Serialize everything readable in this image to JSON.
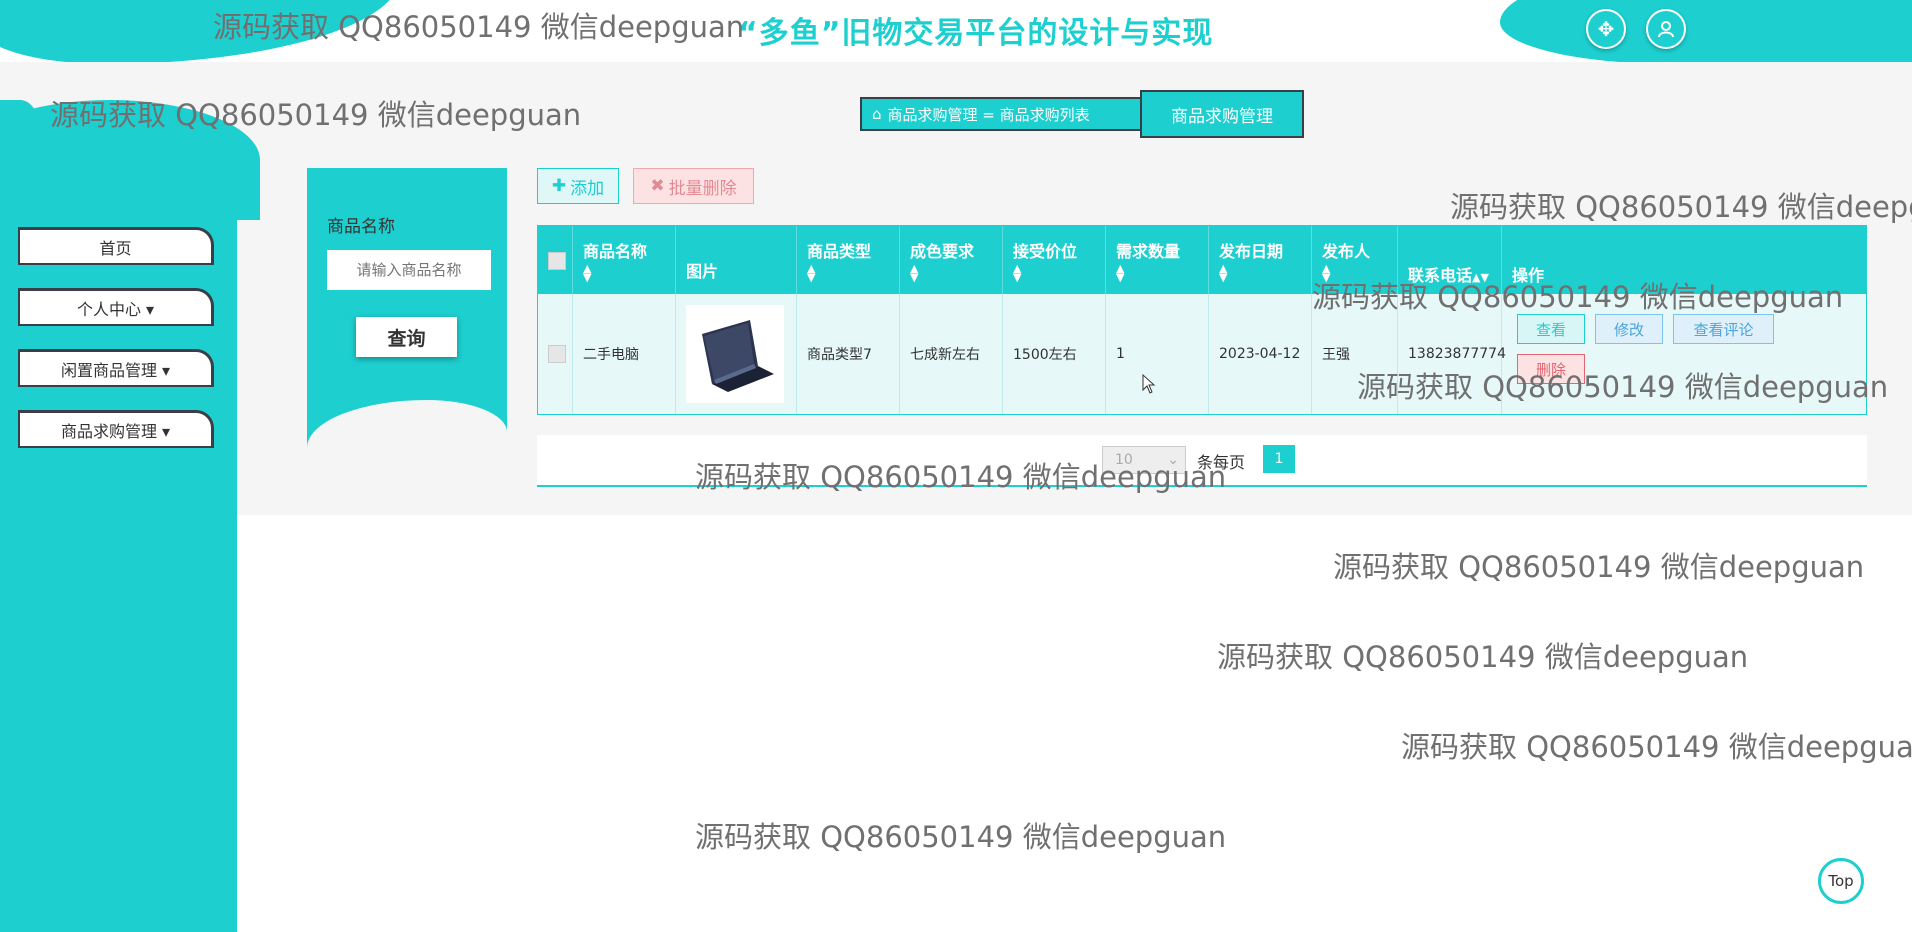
{
  "header": {
    "title": "“多鱼”旧物交易平台的设计与实现",
    "fullscreen_icon": "expand-icon",
    "user_icon": "user-icon"
  },
  "sidebar": {
    "items": [
      {
        "label": "首页"
      },
      {
        "label": "个人中心 ▾"
      },
      {
        "label": "闲置商品管理 ▾"
      },
      {
        "label": "商品求购管理 ▾"
      }
    ]
  },
  "breadcrumb": {
    "home_icon": "home-icon",
    "path": "商品求购管理 = 商品求购列表",
    "current": "商品求购管理"
  },
  "search": {
    "label": "商品名称",
    "placeholder": "请输入商品名称",
    "button": "查询"
  },
  "toolbar": {
    "add": "添加",
    "batch_delete": "批量删除"
  },
  "table": {
    "columns": [
      "商品名称",
      "图片",
      "商品类型",
      "成色要求",
      "接受价位",
      "需求数量",
      "发布日期",
      "发布人",
      "联系电话",
      "操作"
    ],
    "rows": [
      {
        "name": "二手电脑",
        "image": "laptop-photo",
        "type": "商品类型7",
        "condition": "七成新左右",
        "price": "1500左右",
        "quantity": "1",
        "date": "2023-04-12",
        "publisher": "王强",
        "phone": "13823877774",
        "actions": [
          "查看",
          "修改",
          "查看评论",
          "删除"
        ]
      }
    ]
  },
  "pagination": {
    "page_size": "10",
    "per_page_label": "条每页",
    "current_page": "1"
  },
  "watermark": "源码获取 QQ86050149 微信deepguan",
  "top_button": "Top",
  "colors": {
    "accent": "#1ecfd0",
    "danger": "#e26572",
    "info": "#4aa4dd"
  }
}
